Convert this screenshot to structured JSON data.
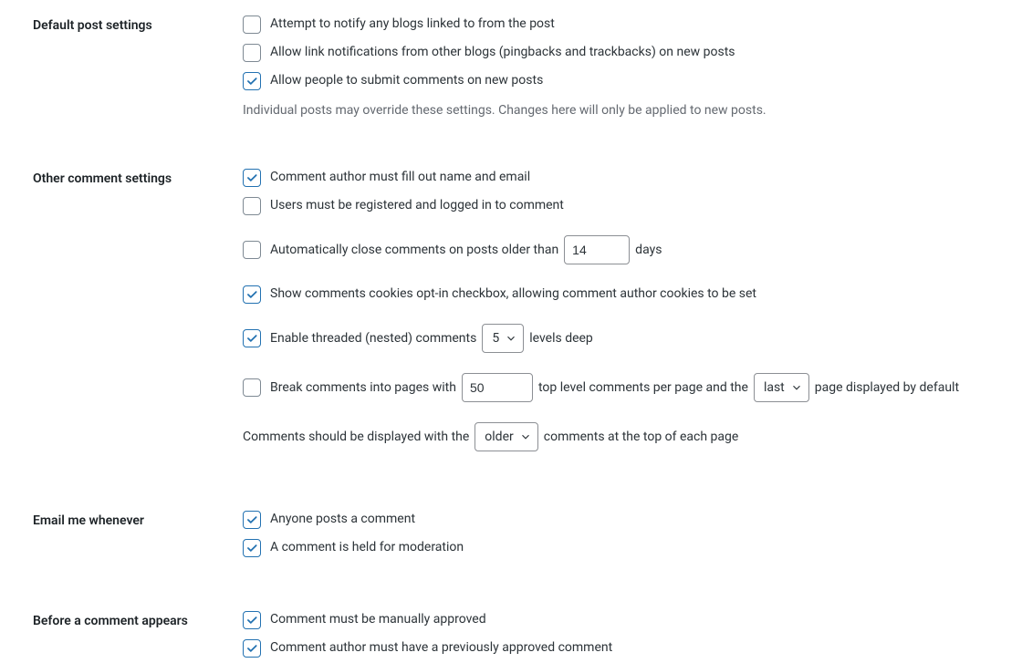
{
  "sections": {
    "default_post": {
      "heading": "Default post settings",
      "items": [
        {
          "label": "Attempt to notify any blogs linked to from the post",
          "checked": false
        },
        {
          "label": "Allow link notifications from other blogs (pingbacks and trackbacks) on new posts",
          "checked": false
        },
        {
          "label": "Allow people to submit comments on new posts",
          "checked": true
        }
      ],
      "help": "Individual posts may override these settings. Changes here will only be applied to new posts."
    },
    "other_comment": {
      "heading": "Other comment settings",
      "fill_name_email": {
        "label": "Comment author must fill out name and email",
        "checked": true
      },
      "must_register": {
        "label": "Users must be registered and logged in to comment",
        "checked": false
      },
      "auto_close": {
        "label_before": "Automatically close comments on posts older than",
        "value": "14",
        "label_after": "days",
        "checked": false
      },
      "cookies_optin": {
        "label": "Show comments cookies opt-in checkbox, allowing comment author cookies to be set",
        "checked": true
      },
      "threaded": {
        "label_before": "Enable threaded (nested) comments",
        "select_value": "5",
        "label_after": "levels deep",
        "checked": true
      },
      "pagination": {
        "label_before": "Break comments into pages with",
        "value": "50",
        "label_mid": "top level comments per page and the",
        "select_value": "last",
        "label_after": "page displayed by default",
        "checked": false
      },
      "order": {
        "label_before": "Comments should be displayed with the",
        "select_value": "older",
        "label_after": "comments at the top of each page"
      }
    },
    "email_me": {
      "heading": "Email me whenever",
      "items": [
        {
          "label": "Anyone posts a comment",
          "checked": true
        },
        {
          "label": "A comment is held for moderation",
          "checked": true
        }
      ]
    },
    "before_appears": {
      "heading": "Before a comment appears",
      "items": [
        {
          "label": "Comment must be manually approved",
          "checked": true
        },
        {
          "label": "Comment author must have a previously approved comment",
          "checked": true
        }
      ]
    }
  }
}
